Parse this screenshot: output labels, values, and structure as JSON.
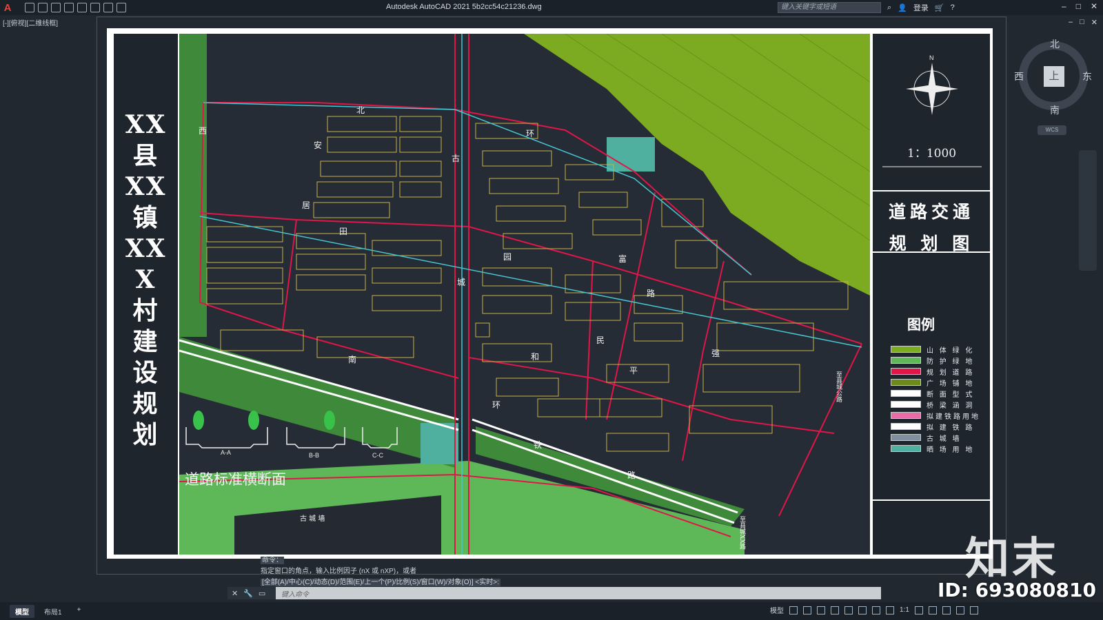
{
  "titlebar": {
    "app_logo": "A",
    "window_title": "Autodesk AutoCAD 2021    5b2cc54c21236.dwg",
    "search_placeholder": "键入关键字或短语",
    "login": "登录",
    "window_buttons": [
      "–",
      "□",
      "✕"
    ]
  },
  "viewport": {
    "view_label": "[-][俯视][二维线框]"
  },
  "sheet": {
    "vertical_title": [
      "XX",
      "县",
      "XX",
      "镇",
      "XX",
      "X",
      "村",
      "建",
      "设",
      "规",
      "划"
    ],
    "scale": "1：1000",
    "drawing_title_line1": "道路交通",
    "drawing_title_line2": "规 划 图",
    "legend_title": "图例",
    "legend": [
      {
        "label": "山 体 绿 化",
        "color": "#7cab22"
      },
      {
        "label": "防 护 绿 地",
        "color": "#5fb858"
      },
      {
        "label": "规 划 道 路",
        "color": "#e01648"
      },
      {
        "label": "广 场 铺 地",
        "color": "#6b8a1a"
      },
      {
        "label": "断 面 型 式",
        "color": "#ffffff"
      },
      {
        "label": "桥 梁 涵 洞",
        "color": "#ffffff"
      },
      {
        "label": "拟建铁路用地",
        "color": "#e96ca6"
      },
      {
        "label": "拟 建 铁 路",
        "color": "#ffffff"
      },
      {
        "label": "古  城  墙",
        "color": "#7f8fa0"
      },
      {
        "label": "晒 场 用 地",
        "color": "#4fb0a0"
      }
    ],
    "section_title": "道路标准横断面",
    "sections": [
      "A-A",
      "B-B",
      "C-C"
    ],
    "map_labels": [
      "北",
      "环",
      "古",
      "西",
      "安",
      "居",
      "田",
      "园",
      "城",
      "富",
      "路",
      "南",
      "和",
      "民",
      "平",
      "强",
      "环",
      "铁",
      "路",
      "古  城  墙",
      "至县城公路",
      "至县城XX路"
    ]
  },
  "navcube": {
    "north": "北",
    "south": "南",
    "east": "东",
    "west": "西",
    "face": "上",
    "wcs": "WCS"
  },
  "command": {
    "history_1": "命令：",
    "history_2": "指定窗口的角点，输入比例因子 (nX 或 nXP)，或者",
    "history_3": "[全部(A)/中心(C)/动态(D)/范围(E)/上一个(P)/比例(S)/窗口(W)/对象(O)] <实时>:",
    "input_placeholder": "键入命令"
  },
  "statusbar": {
    "tabs": [
      "模型",
      "布局1",
      "+"
    ],
    "model_label": "模型",
    "scale": "1:1"
  },
  "watermark": {
    "logo": "知末",
    "id": "ID: 693080810"
  }
}
